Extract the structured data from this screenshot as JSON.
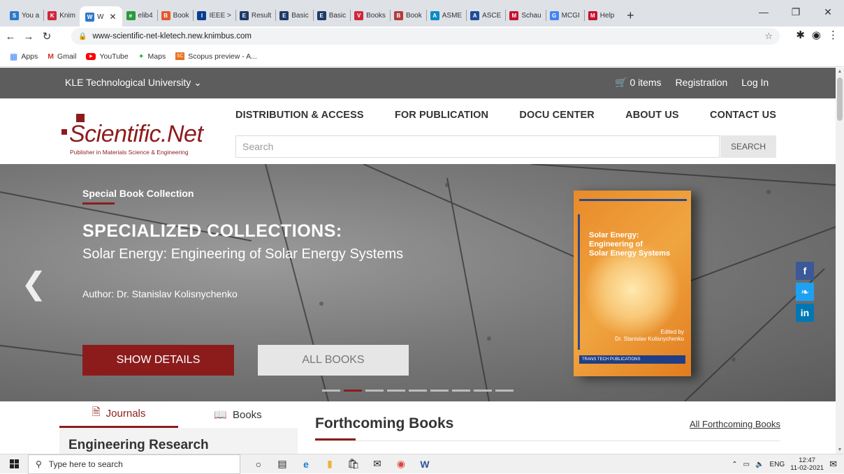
{
  "browser": {
    "tabs": [
      {
        "label": "You a",
        "icon": "scopus-icon",
        "color": "#2e79c9",
        "glyph": "S"
      },
      {
        "label": "Knim",
        "icon": "knimbus-icon",
        "color": "#d1263a",
        "glyph": "K"
      },
      {
        "label": "W",
        "icon": "knimbus-active-icon",
        "color": "#2e79c9",
        "glyph": "W",
        "active": true
      },
      {
        "label": "elib4",
        "icon": "elib-icon",
        "color": "#2b9a3e",
        "glyph": "e"
      },
      {
        "label": "Book",
        "icon": "books-icon",
        "color": "#e4572e",
        "glyph": "B"
      },
      {
        "label": "IEEE >",
        "icon": "ieee-icon",
        "color": "#0b3d91",
        "glyph": "I"
      },
      {
        "label": "Result",
        "icon": "elsevier-icon",
        "color": "#1f3a68",
        "glyph": "E"
      },
      {
        "label": "Basic",
        "icon": "elsevier-icon",
        "color": "#1f3a68",
        "glyph": "E"
      },
      {
        "label": "Basic",
        "icon": "elsevier-icon",
        "color": "#1f3a68",
        "glyph": "E"
      },
      {
        "label": "Books",
        "icon": "v-icon",
        "color": "#d1263a",
        "glyph": "V"
      },
      {
        "label": "Book",
        "icon": "book-icon",
        "color": "#b33b3b",
        "glyph": "B"
      },
      {
        "label": "ASME",
        "icon": "asme-icon",
        "color": "#0a8ac5",
        "glyph": "A"
      },
      {
        "label": "ASCE",
        "icon": "asce-icon",
        "color": "#1f4b99",
        "glyph": "A"
      },
      {
        "label": "Schau",
        "icon": "mcgraw-icon",
        "color": "#c8102e",
        "glyph": "M"
      },
      {
        "label": "MCGI",
        "icon": "google-icon",
        "color": "#4285f4",
        "glyph": "G"
      },
      {
        "label": "Help",
        "icon": "mcgraw-icon",
        "color": "#c8102e",
        "glyph": "M"
      }
    ],
    "new_tab": "+",
    "url": "www-scientific-net-kletech.new.knimbus.com",
    "bookmarks": [
      {
        "label": "Apps",
        "icon": "apps-icon"
      },
      {
        "label": "Gmail",
        "icon": "gmail-icon"
      },
      {
        "label": "YouTube",
        "icon": "youtube-icon"
      },
      {
        "label": "Maps",
        "icon": "maps-icon"
      },
      {
        "label": "Scopus preview - A...",
        "icon": "scopus-icon"
      }
    ]
  },
  "site": {
    "university": "KLE Technological University",
    "cart": "0 items",
    "registration": "Registration",
    "login": "Log In",
    "logo_name": "Scientific.Net",
    "logo_tagline": "Publisher in Materials Science & Engineering",
    "nav": [
      "DISTRIBUTION & ACCESS",
      "FOR PUBLICATION",
      "DOCU CENTER",
      "ABOUT US",
      "CONTACT US"
    ],
    "search_placeholder": "Search",
    "search_button": "SEARCH",
    "hero": {
      "kicker": "Special Book Collection",
      "title": "SPECIALIZED COLLECTIONS:",
      "subtitle": "Solar Energy: Engineering of Solar Energy Systems",
      "author": "Author: Dr. Stanislav Kolisnychenko",
      "show_details": "SHOW DETAILS",
      "all_books": "ALL BOOKS",
      "slides_total": 9,
      "slide_active": 2,
      "book": {
        "title_1": "Solar Energy:",
        "title_2": "Engineering of",
        "title_3": "Solar Energy Systems",
        "edited_by": "Edited by",
        "editor": "Dr. Stanislav Kolisnychenko",
        "publisher": "TRANS TECH PUBLICATIONS"
      }
    },
    "tabs": {
      "journals": "Journals",
      "books": "Books"
    },
    "section_item": "Engineering Research",
    "forthcoming_title": "Forthcoming Books",
    "forthcoming_link": "All Forthcoming Books",
    "colors": {
      "brand": "#8c1c1c",
      "topbar": "#5d5d5d",
      "facebook": "#3b5998",
      "twitter": "#1da1f2",
      "linkedin": "#0077b5"
    }
  },
  "taskbar": {
    "search_placeholder": "Type here to search",
    "language": "ENG",
    "time": "12:47",
    "date": "11-02-2021"
  }
}
